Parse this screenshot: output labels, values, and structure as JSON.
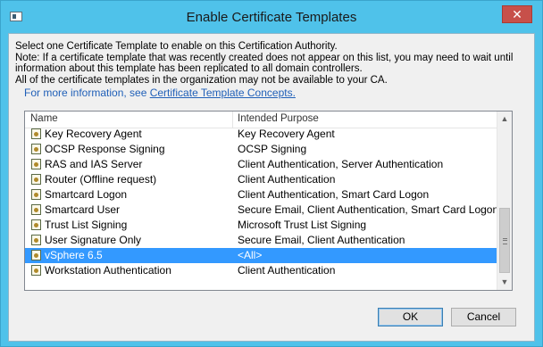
{
  "window": {
    "title": "Enable Certificate Templates",
    "close_label": "✕"
  },
  "intro": {
    "lines": [
      "Select one Certificate Template to enable on this Certification Authority.",
      "Note: If a certificate template that was recently created does not appear on this list, you may need to wait until",
      "information about this template has been replicated to all domain controllers.",
      "All of the certificate templates in the organization may not be available to your CA."
    ],
    "more_info_prefix": "For more information, see ",
    "more_info_link": "Certificate Template Concepts."
  },
  "list": {
    "columns": {
      "name": "Name",
      "purpose": "Intended Purpose"
    },
    "rows": [
      {
        "name": "Key Recovery Agent",
        "purpose": "Key Recovery Agent",
        "selected": false
      },
      {
        "name": "OCSP Response Signing",
        "purpose": "OCSP Signing",
        "selected": false
      },
      {
        "name": "RAS and IAS Server",
        "purpose": "Client Authentication, Server Authentication",
        "selected": false
      },
      {
        "name": "Router (Offline request)",
        "purpose": "Client Authentication",
        "selected": false
      },
      {
        "name": "Smartcard Logon",
        "purpose": "Client Authentication, Smart Card Logon",
        "selected": false
      },
      {
        "name": "Smartcard User",
        "purpose": "Secure Email, Client Authentication, Smart Card Logon",
        "selected": false
      },
      {
        "name": "Trust List Signing",
        "purpose": "Microsoft Trust List Signing",
        "selected": false
      },
      {
        "name": "User Signature Only",
        "purpose": "Secure Email, Client Authentication",
        "selected": false
      },
      {
        "name": "vSphere 6.5",
        "purpose": "<All>",
        "selected": true
      },
      {
        "name": "Workstation Authentication",
        "purpose": "Client Authentication",
        "selected": false
      }
    ],
    "scroll_position": 0.75
  },
  "buttons": {
    "ok": "OK",
    "cancel": "Cancel"
  },
  "colors": {
    "titlebar": "#4fc2ea",
    "selection": "#3399ff",
    "link": "#2060b8",
    "close": "#c7504a"
  }
}
